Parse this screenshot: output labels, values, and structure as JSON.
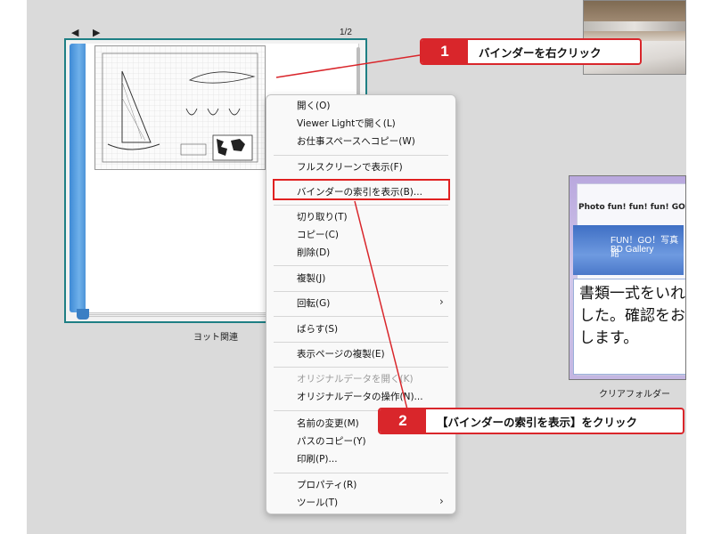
{
  "binder": {
    "nav_arrows": "◀ ▶",
    "page_indicator": "1/2",
    "label": "ヨット関連"
  },
  "folder": {
    "site_title": "Photo fun! fun! fun! GO!",
    "banner_lines": [
      "FUN！GO！写真館",
      "BD Gallery"
    ],
    "note_text": "書類一式をいれ\nした。確認をお願\nします。",
    "label": "クリアフォルダー"
  },
  "context_menu": {
    "items": [
      {
        "label": "開く(O)"
      },
      {
        "label": "Viewer Lightで開く(L)"
      },
      {
        "label": "お仕事スペースへコピー(W)"
      },
      {
        "label": "フルスクリーンで表示(F)"
      },
      {
        "label": "バインダーの索引を表示(B)..."
      },
      {
        "label": "切り取り(T)"
      },
      {
        "label": "コピー(C)"
      },
      {
        "label": "削除(D)"
      },
      {
        "label": "複製(J)"
      },
      {
        "label": "回転(G)"
      },
      {
        "label": "ばらす(S)"
      },
      {
        "label": "表示ページの複製(E)"
      },
      {
        "label": "オリジナルデータを開く(K)",
        "disabled": true
      },
      {
        "label": "オリジナルデータの操作(N)..."
      },
      {
        "label": "名前の変更(M)"
      },
      {
        "label": "パスのコピー(Y)"
      },
      {
        "label": "印刷(P)..."
      },
      {
        "label": "プロパティ(R)"
      },
      {
        "label": "ツール(T)"
      }
    ],
    "submenu_arrow": "›"
  },
  "callouts": [
    {
      "number": "1",
      "text": "バインダーを右クリック"
    },
    {
      "number": "2",
      "text": "【バインダーの索引を表示】をクリック"
    }
  ],
  "colors": {
    "accent_red": "#d9262b",
    "binder_border": "#1e7f84",
    "spine_blue": "#3e8ad6"
  }
}
